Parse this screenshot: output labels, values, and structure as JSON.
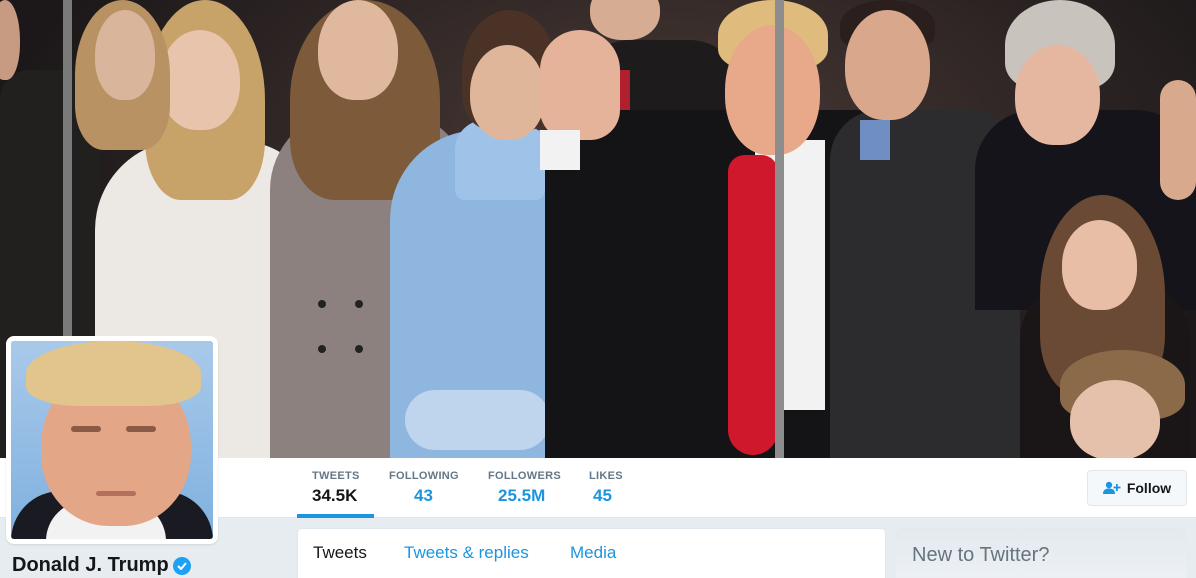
{
  "profile": {
    "name": "Donald J. Trump",
    "verified": true,
    "verified_icon": "verified-badge-icon"
  },
  "nav": {
    "items": [
      {
        "label": "TWEETS",
        "value": "34.5K",
        "active": true
      },
      {
        "label": "FOLLOWING",
        "value": "43",
        "active": false
      },
      {
        "label": "FOLLOWERS",
        "value": "25.5M",
        "active": false
      },
      {
        "label": "LIKES",
        "value": "45",
        "active": false
      }
    ],
    "follow_label": "Follow",
    "follow_icon": "add-user-icon"
  },
  "timeline": {
    "tabs": [
      {
        "label": "Tweets",
        "active": true
      },
      {
        "label": "Tweets & replies",
        "active": false
      },
      {
        "label": "Media",
        "active": false
      }
    ]
  },
  "sidebar": {
    "title": "New to Twitter?"
  },
  "colors": {
    "accent": "#1b95e0",
    "background": "#e6ecf0",
    "verified": "#1da1f2"
  }
}
